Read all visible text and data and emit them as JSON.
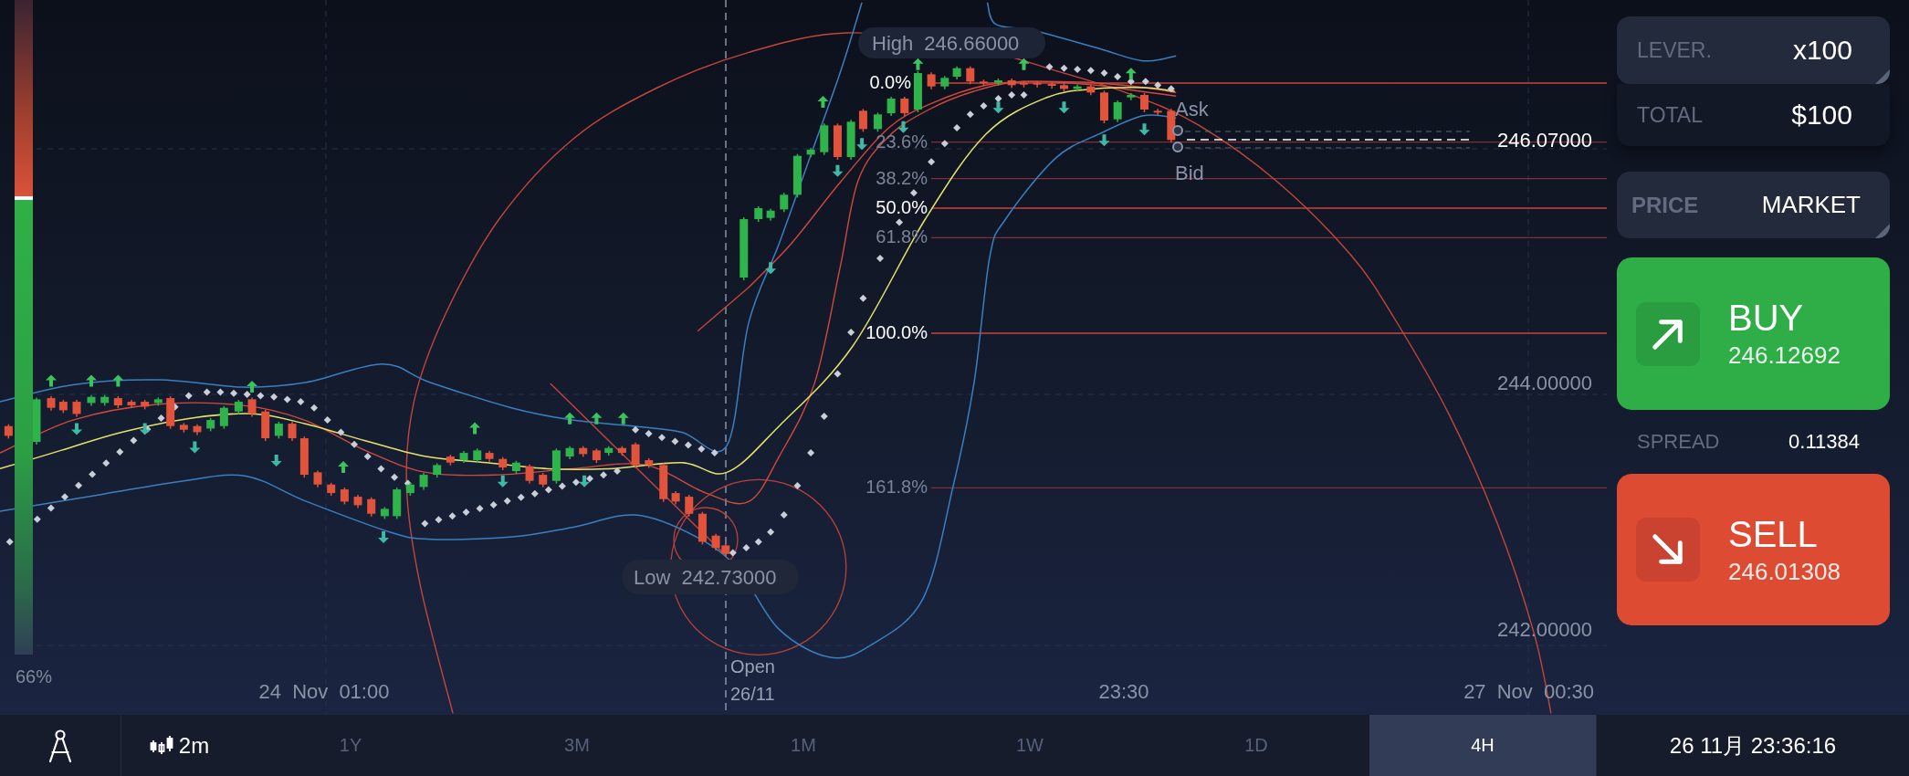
{
  "chart": {
    "sentiment_meter": {
      "level": 0.7,
      "reading": "66%"
    },
    "high_label": "High 246.66000",
    "fibonacci_levels": [
      {
        "label": "0.0%",
        "emphasized": true
      },
      {
        "label": "23.6%",
        "emphasized": false
      },
      {
        "label": "38.2%",
        "emphasized": false
      },
      {
        "label": "50.0%",
        "emphasized": true
      },
      {
        "label": "61.8%",
        "emphasized": false
      },
      {
        "label": "100.0%",
        "emphasized": true
      },
      {
        "label": "161.8%",
        "emphasized": false
      }
    ],
    "ask_label": "Ask",
    "bid_label": "Bid",
    "current_price": "246.07000",
    "price_axis": [
      "244.00000",
      "242.00000"
    ],
    "low_label": "Low 242.73000",
    "open_marker": {
      "caption": "Open",
      "date": "26/11"
    },
    "time_axis": [
      "24 Nov 01:00",
      "23:30",
      "27 Nov 00:30"
    ]
  },
  "order_panel": {
    "leverage": {
      "label": "LEVER.",
      "value": "x100"
    },
    "total": {
      "label": "TOTAL",
      "value": "$100"
    },
    "price": {
      "label": "PRICE",
      "value": "MARKET"
    },
    "buy": {
      "label": "BUY",
      "price": "246.12692"
    },
    "spread": {
      "label": "SPREAD",
      "value": "0.11384"
    },
    "sell": {
      "label": "SELL",
      "price": "246.01308"
    }
  },
  "toolbar": {
    "chart_interval": "2m",
    "periods": [
      {
        "label": "1Y",
        "selected": false
      },
      {
        "label": "3M",
        "selected": false
      },
      {
        "label": "1M",
        "selected": false
      },
      {
        "label": "1W",
        "selected": false
      },
      {
        "label": "1D",
        "selected": false
      },
      {
        "label": "4H",
        "selected": true
      }
    ],
    "clock": "26 11月 23:36:16"
  }
}
